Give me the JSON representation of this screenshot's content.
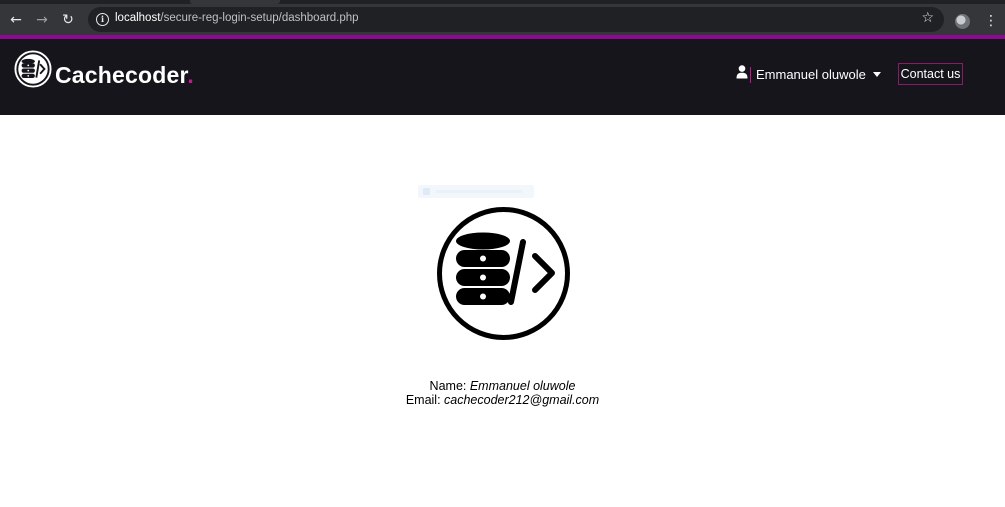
{
  "browser": {
    "url_host": "localhost",
    "url_path": "/secure-reg-login-setup/dashboard.php",
    "icons": [
      "back-arrow-icon",
      "forward-arrow-icon",
      "reload-icon",
      "site-info-icon",
      "bookmark-star-icon",
      "profile-avatar-icon",
      "more-options-icon"
    ]
  },
  "header": {
    "brand": "Cachecoder",
    "brand_dot": ".",
    "user_name": "Emmanuel oluwole",
    "contact_label": "Contact us"
  },
  "profile": {
    "name_label": "Name: ",
    "name_value": "Emmanuel oluwole",
    "email_label": "Email: ",
    "email_value": "cachecoder212@gmail.com"
  },
  "colors": {
    "accent": "#8b0a8f",
    "brand_dot": "#c4168d",
    "header_bg": "#16151c"
  }
}
